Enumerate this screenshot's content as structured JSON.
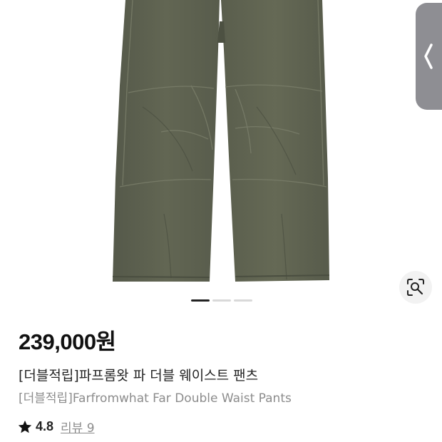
{
  "product": {
    "price": "239,000원",
    "title": "[더블적립]파프롬왓 파 더블 웨이스트 팬츠",
    "subtitle": "[더블적립]Farfromwhat Far Double Waist Pants",
    "rating": "4.8",
    "review_link": "리뷰 9"
  },
  "gallery": {
    "page_count": 3,
    "active_index": 0
  },
  "icons": {
    "side_tab": "chevron-left-icon",
    "lens": "lens-search-icon",
    "rating": "star-icon"
  },
  "colors": {
    "pants": "#5c6150",
    "side_tab": "#8e8e93",
    "active_dot": "#222222",
    "inactive_dot": "#d9d9d9"
  }
}
